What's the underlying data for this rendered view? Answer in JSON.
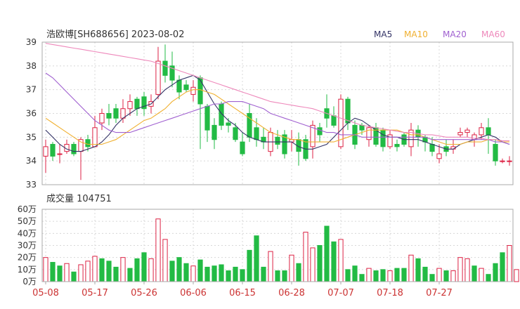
{
  "chart_data": [
    {
      "type": "candlestick",
      "title": "浩欧博[SH688656] 2023-08-02",
      "legend": [
        {
          "name": "MA5",
          "color": "#333366"
        },
        {
          "name": "MA10",
          "color": "#f0b030"
        },
        {
          "name": "MA20",
          "color": "#a060d0"
        },
        {
          "name": "MA60",
          "color": "#ee88bb"
        }
      ],
      "ylim": [
        33,
        39
      ],
      "yticks": [
        33,
        34,
        35,
        36,
        37,
        38,
        39
      ],
      "up_color": "#dd2244",
      "down_color": "#22bb44",
      "dates": [
        "05-08",
        "05-17",
        "05-26",
        "06-06",
        "06-15",
        "06-28",
        "07-07",
        "07-18",
        "07-27"
      ],
      "date_index": [
        0,
        7,
        14,
        21,
        28,
        35,
        42,
        49,
        56
      ],
      "candles": [
        [
          34.2,
          34.6,
          34.9,
          33.5
        ],
        [
          34.7,
          34.2,
          34.8,
          34.0
        ],
        [
          34.3,
          34.3,
          34.7,
          33.9
        ],
        [
          34.4,
          34.7,
          34.9,
          34.3
        ],
        [
          34.7,
          34.3,
          34.8,
          34.2
        ],
        [
          34.4,
          34.9,
          35.0,
          33.2
        ],
        [
          34.9,
          34.6,
          35.1,
          34.4
        ],
        [
          34.6,
          35.4,
          35.9,
          34.6
        ],
        [
          35.6,
          36.0,
          36.2,
          35.3
        ],
        [
          36.0,
          35.8,
          36.4,
          35.5
        ],
        [
          36.2,
          35.8,
          36.4,
          35.6
        ],
        [
          35.8,
          36.2,
          36.6,
          35.6
        ],
        [
          36.2,
          36.5,
          36.8,
          35.9
        ],
        [
          36.6,
          36.2,
          36.7,
          35.9
        ],
        [
          36.7,
          36.2,
          36.9,
          35.9
        ],
        [
          36.3,
          36.5,
          36.8,
          36.0
        ],
        [
          36.8,
          38.2,
          38.8,
          36.6
        ],
        [
          38.2,
          37.6,
          38.9,
          37.3
        ],
        [
          38.0,
          37.4,
          38.6,
          37.1
        ],
        [
          37.4,
          36.9,
          37.6,
          36.6
        ],
        [
          37.2,
          37.0,
          37.4,
          36.9
        ],
        [
          36.8,
          37.1,
          37.4,
          36.5
        ],
        [
          37.5,
          36.4,
          37.6,
          34.5
        ],
        [
          36.3,
          35.3,
          36.4,
          34.8
        ],
        [
          35.5,
          34.9,
          35.8,
          34.5
        ],
        [
          36.4,
          35.5,
          36.5,
          35.3
        ],
        [
          35.6,
          35.5,
          35.8,
          35.2
        ],
        [
          35.4,
          34.9,
          35.6,
          34.8
        ],
        [
          34.8,
          34.3,
          35.2,
          34.2
        ],
        [
          36.0,
          35.0,
          36.4,
          34.8
        ],
        [
          35.4,
          34.9,
          35.8,
          34.6
        ],
        [
          35.0,
          34.8,
          35.4,
          34.5
        ],
        [
          34.4,
          35.2,
          35.4,
          34.2
        ],
        [
          35.0,
          34.7,
          35.3,
          34.5
        ],
        [
          35.1,
          34.3,
          35.3,
          34.1
        ],
        [
          34.8,
          34.9,
          35.3,
          34.4
        ],
        [
          34.9,
          34.4,
          35.2,
          33.8
        ],
        [
          34.9,
          34.1,
          35.1,
          34.0
        ],
        [
          34.6,
          35.5,
          35.7,
          34.1
        ],
        [
          35.4,
          35.1,
          35.6,
          34.8
        ],
        [
          36.2,
          35.8,
          36.8,
          35.4
        ],
        [
          35.9,
          35.5,
          36.3,
          35.4
        ],
        [
          34.6,
          36.6,
          36.8,
          34.5
        ],
        [
          36.6,
          35.6,
          36.7,
          35.3
        ],
        [
          35.5,
          34.7,
          35.7,
          34.5
        ],
        [
          35.5,
          35.3,
          35.6,
          35.1
        ],
        [
          34.9,
          35.4,
          35.5,
          34.6
        ],
        [
          35.4,
          34.7,
          35.6,
          34.6
        ],
        [
          35.3,
          34.6,
          35.4,
          34.4
        ],
        [
          34.6,
          35.1,
          35.3,
          34.5
        ],
        [
          34.7,
          34.6,
          34.9,
          34.4
        ],
        [
          35.1,
          34.7,
          35.2,
          34.6
        ],
        [
          34.6,
          35.3,
          35.6,
          34.2
        ],
        [
          35.3,
          35.0,
          35.5,
          34.6
        ],
        [
          35.0,
          34.8,
          35.1,
          34.4
        ],
        [
          34.7,
          34.4,
          35.0,
          34.2
        ],
        [
          34.1,
          34.3,
          34.7,
          33.9
        ],
        [
          34.6,
          34.4,
          34.9,
          34.2
        ],
        [
          34.5,
          34.6,
          34.9,
          34.3
        ],
        [
          35.1,
          35.2,
          35.4,
          35.0
        ],
        [
          35.2,
          35.3,
          35.4,
          35.0
        ],
        [
          34.9,
          35.1,
          35.2,
          34.6
        ],
        [
          35.1,
          35.4,
          35.6,
          34.9
        ],
        [
          35.4,
          35.1,
          35.8,
          34.3
        ],
        [
          34.7,
          34.0,
          34.9,
          33.8
        ],
        [
          34.0,
          34.0,
          34.1,
          33.9
        ],
        [
          34.0,
          34.0,
          34.2,
          33.8
        ]
      ],
      "ma": {
        "MA5": [
          35.3,
          35.0,
          34.7,
          34.5,
          34.4,
          34.4,
          34.5,
          34.6,
          34.8,
          35.1,
          35.5,
          35.8,
          36.0,
          36.2,
          36.3,
          36.4,
          36.7,
          37.0,
          37.2,
          37.4,
          37.5,
          37.6,
          37.4,
          36.9,
          36.4,
          36.0,
          35.7,
          35.5,
          35.2,
          35.0,
          34.9,
          34.8,
          34.8,
          34.8,
          34.8,
          34.8,
          34.6,
          34.5,
          34.5,
          34.6,
          34.7,
          35.0,
          35.3,
          35.6,
          35.8,
          35.7,
          35.5,
          35.3,
          35.1,
          35.0,
          35.0,
          34.9,
          34.9,
          34.9,
          34.8,
          34.7,
          34.6,
          34.5,
          34.5,
          34.7,
          34.8,
          34.9,
          35.0,
          35.1,
          35.0,
          34.8,
          34.7
        ],
        "MA10": [
          35.8,
          35.6,
          35.4,
          35.2,
          35.0,
          34.8,
          34.7,
          34.7,
          34.7,
          34.8,
          34.9,
          35.1,
          35.3,
          35.5,
          35.7,
          35.8,
          36.0,
          36.2,
          36.5,
          36.7,
          36.9,
          37.0,
          37.0,
          36.9,
          36.8,
          36.6,
          36.4,
          36.2,
          36.0,
          35.8,
          35.6,
          35.4,
          35.2,
          35.1,
          35.0,
          34.9,
          34.9,
          34.8,
          34.8,
          34.8,
          34.8,
          34.8,
          34.9,
          35.0,
          35.1,
          35.2,
          35.3,
          35.3,
          35.3,
          35.3,
          35.3,
          35.2,
          35.1,
          35.1,
          35.0,
          34.9,
          34.8,
          34.7,
          34.7,
          34.7,
          34.8,
          34.8,
          34.8,
          34.9,
          34.9,
          34.8,
          34.8
        ],
        "MA20": [
          37.7,
          37.5,
          37.2,
          36.9,
          36.6,
          36.3,
          36.0,
          35.7,
          35.5,
          35.3,
          35.2,
          35.2,
          35.2,
          35.3,
          35.4,
          35.5,
          35.6,
          35.7,
          35.8,
          35.9,
          36.0,
          36.1,
          36.2,
          36.3,
          36.4,
          36.4,
          36.5,
          36.5,
          36.5,
          36.4,
          36.3,
          36.2,
          36.0,
          35.9,
          35.8,
          35.7,
          35.6,
          35.5,
          35.4,
          35.3,
          35.2,
          35.2,
          35.1,
          35.1,
          35.1,
          35.0,
          35.0,
          35.0,
          35.0,
          35.0,
          35.0,
          35.0,
          35.0,
          35.0,
          35.0,
          34.9,
          34.9,
          34.9,
          34.9,
          34.9,
          34.9,
          34.9,
          34.9,
          34.9,
          34.8,
          34.8,
          34.7
        ],
        "MA60": [
          38.95,
          38.9,
          38.85,
          38.8,
          38.75,
          38.7,
          38.65,
          38.6,
          38.55,
          38.5,
          38.45,
          38.4,
          38.35,
          38.3,
          38.25,
          38.2,
          38.1,
          38.0,
          37.9,
          37.8,
          37.7,
          37.6,
          37.5,
          37.4,
          37.3,
          37.2,
          37.1,
          37.0,
          36.9,
          36.8,
          36.7,
          36.6,
          36.5,
          36.45,
          36.4,
          36.35,
          36.3,
          36.25,
          36.2,
          36.1,
          36.0,
          35.9,
          35.8,
          35.7,
          35.6,
          35.5,
          35.45,
          35.4,
          35.35,
          35.3,
          35.25,
          35.2,
          35.2,
          35.15,
          35.1,
          35.1,
          35.05,
          35.0,
          35.0,
          35.0,
          35.0,
          34.95,
          34.95,
          34.9,
          34.9,
          34.85,
          34.85
        ]
      }
    },
    {
      "type": "bar",
      "title": "成交量 104751",
      "ylim": [
        0,
        60
      ],
      "yticks": [
        0,
        10,
        20,
        30,
        40,
        50,
        60
      ],
      "ytick_labels": [
        "0万",
        "10万",
        "20万",
        "30万",
        "40万",
        "50万",
        "60万"
      ],
      "unit": "万",
      "values": [
        20,
        16,
        13,
        15,
        8,
        14,
        17,
        21,
        19,
        17,
        12,
        20,
        11,
        19,
        24,
        19,
        52,
        35,
        17,
        20,
        15,
        13,
        18,
        12,
        13,
        14,
        9,
        12,
        10,
        26,
        38,
        12,
        25,
        9,
        9,
        22,
        15,
        41,
        28,
        30,
        46,
        33,
        35,
        10,
        13,
        6,
        11,
        9,
        10,
        9,
        11,
        11,
        22,
        19,
        12,
        6,
        11,
        9,
        9,
        20,
        19,
        13,
        11,
        6,
        15,
        24,
        30,
        10
      ],
      "bar_up": [
        1,
        0,
        0,
        1,
        0,
        1,
        1,
        1,
        0,
        0,
        0,
        1,
        0,
        0,
        0,
        1,
        1,
        1,
        0,
        0,
        0,
        1,
        0,
        0,
        0,
        0,
        0,
        0,
        0,
        0,
        0,
        0,
        1,
        0,
        0,
        1,
        0,
        1,
        1,
        0,
        0,
        0,
        1,
        0,
        0,
        0,
        1,
        0,
        0,
        1,
        0,
        0,
        1,
        0,
        0,
        0,
        1,
        0,
        1,
        1,
        1,
        0,
        1,
        0,
        0,
        0,
        1,
        1
      ]
    }
  ]
}
